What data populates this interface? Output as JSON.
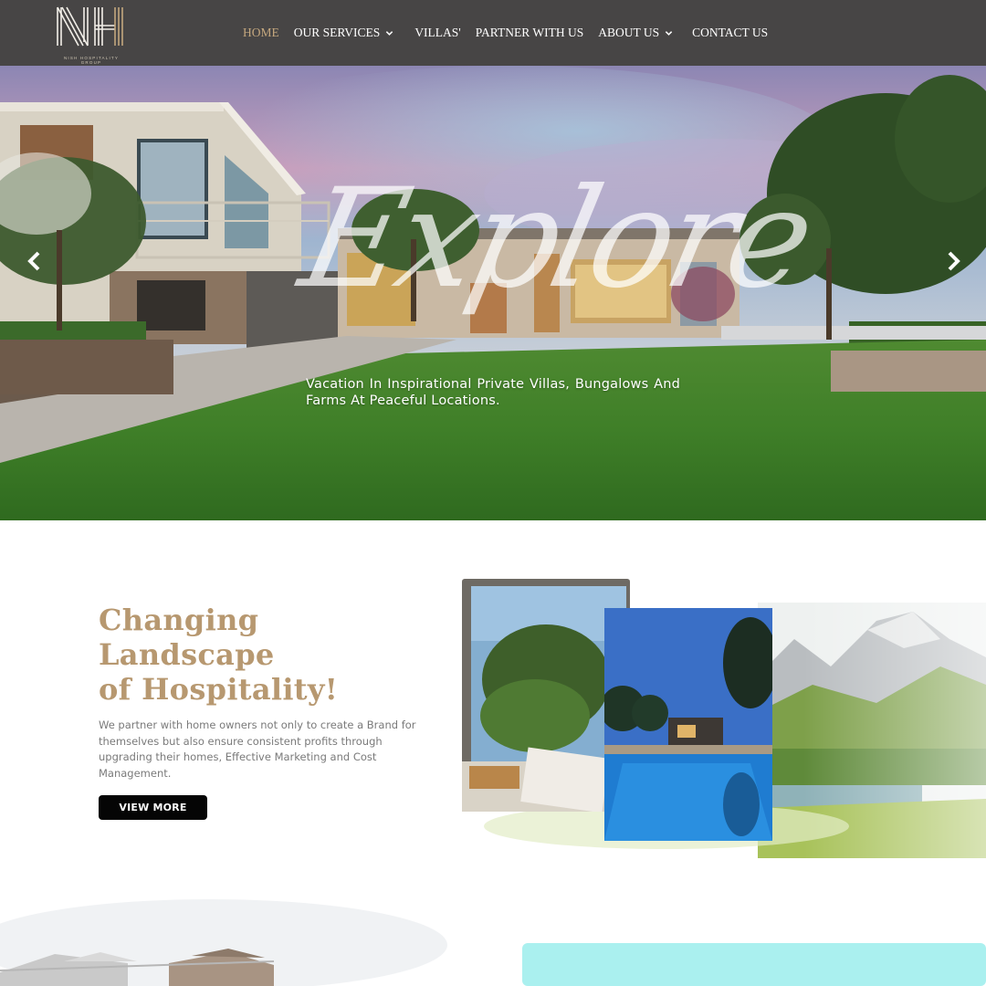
{
  "brand": {
    "logo_letters": "NH",
    "tagline": "NISH HOSPITALITY GROUP"
  },
  "nav": {
    "items": [
      {
        "label": "HOME",
        "active": true,
        "dropdown": false
      },
      {
        "label": "OUR SERVICES",
        "active": false,
        "dropdown": true
      },
      {
        "label": "VILLAS'",
        "active": false,
        "dropdown": false
      },
      {
        "label": "PARTNER WITH US",
        "active": false,
        "dropdown": false
      },
      {
        "label": "ABOUT US",
        "active": false,
        "dropdown": true
      },
      {
        "label": "CONTACT US",
        "active": false,
        "dropdown": false
      }
    ]
  },
  "hero": {
    "script_word": "Explore",
    "caption": "Vacation In Inspirational Private Villas, Bungalows And Farms At Peaceful Locations.",
    "prev_icon": "chevron-left-icon",
    "next_icon": "chevron-right-icon"
  },
  "about": {
    "title_line1": "Changing",
    "title_line2": "Landscape",
    "title_line3": "of Hospitality!",
    "body": "We partner with home owners not only to create a Brand for themselves but also ensure consistent profits through upgrading their homes, Effective Marketing and Cost Management.",
    "button_label": "VIEW MORE"
  },
  "colors": {
    "header_bg": "#474545",
    "nav_active": "#c4a77e",
    "accent_gold": "#b79870",
    "button_bg": "#050505"
  }
}
